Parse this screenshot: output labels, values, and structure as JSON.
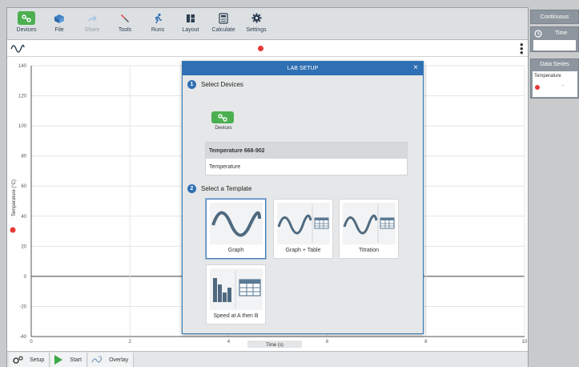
{
  "toolbar": {
    "items": [
      {
        "label": "Devices",
        "icon": "devices-icon"
      },
      {
        "label": "File",
        "icon": "file-icon"
      },
      {
        "label": "Share",
        "icon": "share-icon"
      },
      {
        "label": "Tools",
        "icon": "tools-icon"
      },
      {
        "label": "Runs",
        "icon": "runs-icon"
      },
      {
        "label": "Layout",
        "icon": "layout-icon"
      },
      {
        "label": "Calculate",
        "icon": "calculator-icon"
      },
      {
        "label": "Settings",
        "icon": "gear-icon"
      }
    ]
  },
  "graph": {
    "y_axis_label": "Temperature (°C)",
    "x_axis_label": "Time (s)",
    "y_ticks": [
      "140",
      "120",
      "100",
      "80",
      "60",
      "40",
      "20",
      "0",
      "-20",
      "-40"
    ],
    "x_ticks": [
      "0",
      "2",
      "4",
      "6",
      "8",
      "10"
    ]
  },
  "bottom_bar": {
    "setup": "Setup",
    "start": "Start",
    "overlay": "Overlay"
  },
  "sidebar": {
    "mode": "Continuous",
    "time_label": "Time",
    "time_value": "",
    "data_series_title": "Data Series",
    "series_name": "Temperature",
    "series_value": "--"
  },
  "modal": {
    "title": "LAB SETUP",
    "close": "×",
    "step1_num": "1",
    "step1_label": "Select Devices",
    "devices_button_label": "Devices",
    "sensor_name": "Temperature 668-902",
    "sensor_measurement": "Temperature",
    "step2_num": "2",
    "step2_label": "Select a Template",
    "templates": [
      {
        "label": "Graph"
      },
      {
        "label": "Graph + Table"
      },
      {
        "label": "Titration"
      },
      {
        "label": "Speed at A then B"
      }
    ]
  },
  "colors": {
    "accent_blue": "#2f6fb3",
    "device_green": "#4caf50",
    "record_red": "#e53935",
    "side_panel": "#8d969e"
  }
}
